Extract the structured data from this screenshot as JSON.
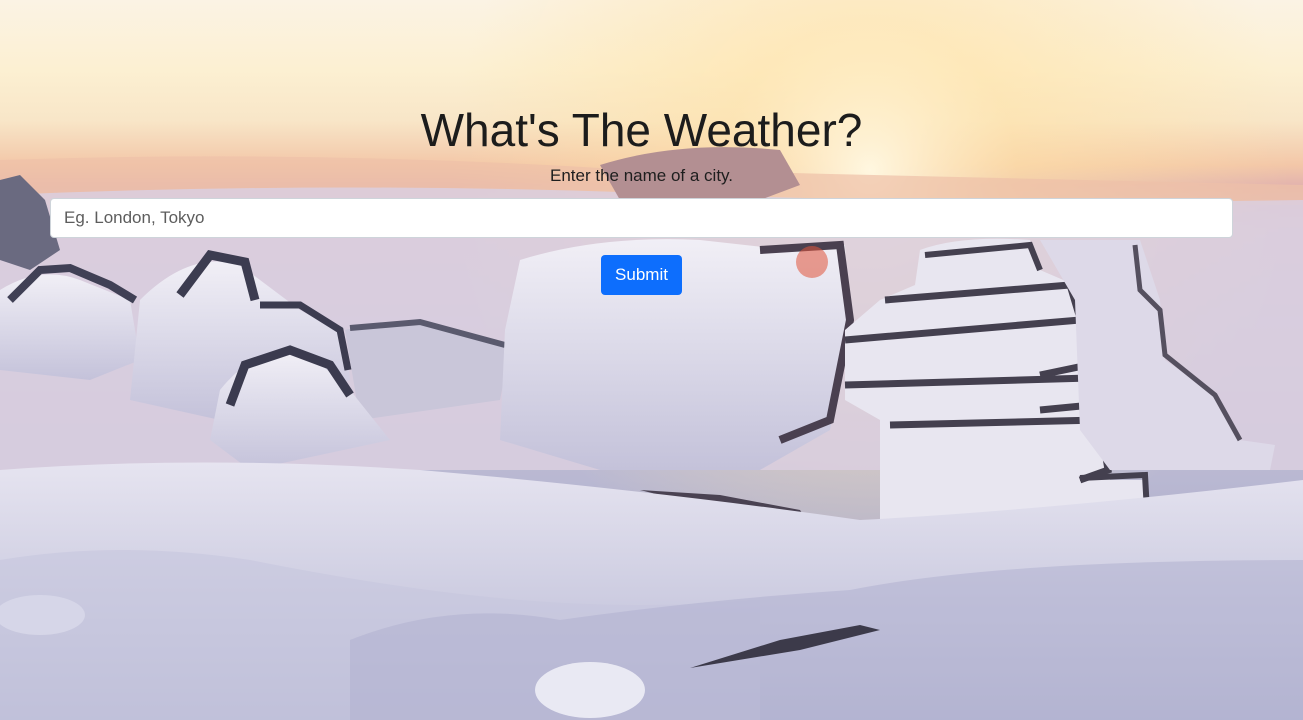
{
  "header": {
    "title": "What's The Weather?",
    "subtitle": "Enter the name of a city."
  },
  "search": {
    "placeholder": "Eg. London, Tokyo",
    "value": ""
  },
  "form": {
    "submit_label": "Submit"
  },
  "background": {
    "scene": "snow-covered-rock-cairns-at-sunset"
  },
  "colors": {
    "accent": "#0d6efd",
    "title_text": "#1c1c1c"
  }
}
